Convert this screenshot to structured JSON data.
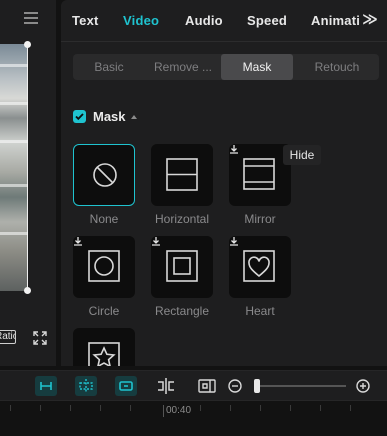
{
  "preview": {
    "ratio_label": "Ratio"
  },
  "tabs": [
    {
      "label": "Text"
    },
    {
      "label": "Video"
    },
    {
      "label": "Audio"
    },
    {
      "label": "Speed"
    },
    {
      "label": "Animation"
    }
  ],
  "active_tab": "Video",
  "segments": [
    {
      "label": "Basic"
    },
    {
      "label": "Remove ..."
    },
    {
      "label": "Mask"
    },
    {
      "label": "Retouch"
    }
  ],
  "active_segment": "Mask",
  "mask_section": {
    "title": "Mask",
    "enabled": true
  },
  "masks": [
    {
      "label": "None",
      "icon": "none-circle-slash-icon",
      "selected": true
    },
    {
      "label": "Horizontal",
      "icon": "horizontal-split-icon",
      "selected": false
    },
    {
      "label": "Mirror",
      "icon": "mirror-icon",
      "selected": false
    },
    {
      "label": "Circle",
      "icon": "circle-mask-icon",
      "selected": false
    },
    {
      "label": "Rectangle",
      "icon": "rectangle-mask-icon",
      "selected": false
    },
    {
      "label": "Heart",
      "icon": "heart-mask-icon",
      "selected": false
    },
    {
      "label": "",
      "icon": "star-mask-icon",
      "selected": false
    }
  ],
  "tooltip": {
    "text": "Hide"
  },
  "timeline": {
    "time_marker": "00:40"
  },
  "colors": {
    "accent": "#1fc3cf",
    "panel": "#1e1e1f",
    "background": "#121212",
    "tile": "#0d0d0d"
  }
}
